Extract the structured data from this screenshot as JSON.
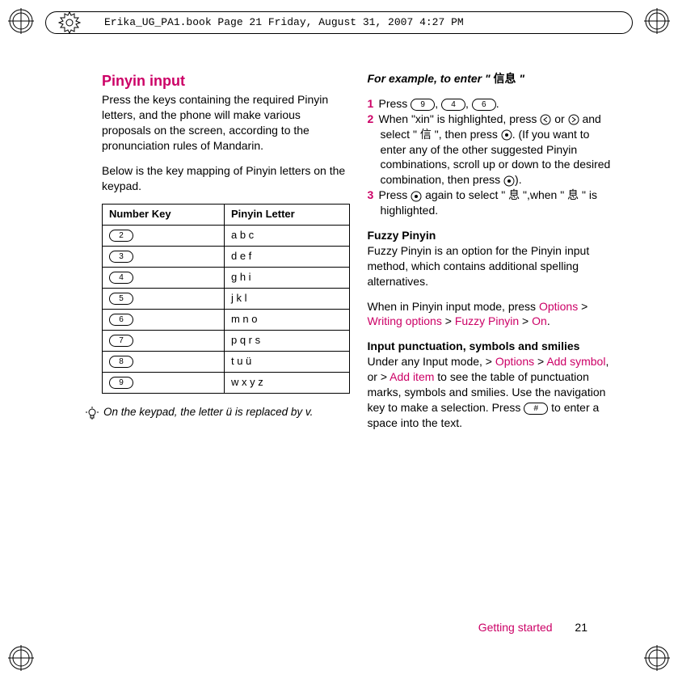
{
  "header": {
    "text": "Erika_UG_PA1.book  Page 21  Friday, August 31, 2007  4:27 PM"
  },
  "left": {
    "title": "Pinyin input",
    "intro": "Press the keys containing the required Pinyin letters, and the phone will make various proposals on the screen, according to the pronunciation rules of Mandarin.",
    "below": "Below is the key mapping of Pinyin letters on the keypad.",
    "table": {
      "head_key": "Number Key",
      "head_letter": "Pinyin Letter",
      "rows": [
        {
          "key": "2",
          "letters": "a b c"
        },
        {
          "key": "3",
          "letters": "d e f"
        },
        {
          "key": "4",
          "letters": "g h i"
        },
        {
          "key": "5",
          "letters": "j k l"
        },
        {
          "key": "6",
          "letters": "m n o"
        },
        {
          "key": "7",
          "letters": "p q r s"
        },
        {
          "key": "8",
          "letters": "t u ü"
        },
        {
          "key": "9",
          "letters": "w x y z"
        }
      ]
    },
    "tip": "On the keypad, the letter ü is replaced by v."
  },
  "right": {
    "example_title_prefix": "For example, to enter \" ",
    "example_title_chars": "信息",
    "example_title_suffix": " \"",
    "step1": {
      "num": "1",
      "a": "Press ",
      "k1": "9",
      "c1": ", ",
      "k2": "4",
      "c2": ", ",
      "k3": "6",
      "end": "."
    },
    "step2": {
      "num": "2",
      "a": "When \"xin\" is highlighted, press ",
      "b": " or ",
      "c": " and select \" ",
      "char1": "信",
      "d": " \", then press ",
      "e": ". (If you want to enter any of the other suggested Pinyin combinations, scroll up or down to the desired combination, then press ",
      "f": ")."
    },
    "step3": {
      "num": "3",
      "a": "Press ",
      "b": " again to select \" ",
      "char1": "息",
      "c": " \",when \" ",
      "char2": "息",
      "d": " \" is highlighted."
    },
    "fuzzy_title": "Fuzzy Pinyin",
    "fuzzy_body": "Fuzzy Pinyin is an option for the Pinyin input method, which contains additional spelling alternatives.",
    "fuzzy_nav_prefix": "When in Pinyin input mode, press ",
    "nav_options": "Options",
    "gt": " > ",
    "nav_writing": "Writing options",
    "nav_fuzzy": "Fuzzy Pinyin",
    "nav_on": "On",
    "period": ".",
    "punct_title": "Input punctuation, symbols and smilies",
    "punct_a": "Under any Input mode, > ",
    "nav_options2": "Options",
    "punct_b": " > ",
    "nav_addsymbol": "Add symbol",
    "punct_c": ", or > ",
    "nav_additem": "Add item",
    "punct_d": " to see the table of punctuation marks, symbols and smilies. Use the navigation key to make a selection. Press ",
    "hash_key": "#",
    "punct_e": " to enter a space into the text."
  },
  "footer": {
    "section": "Getting started",
    "page": "21"
  }
}
